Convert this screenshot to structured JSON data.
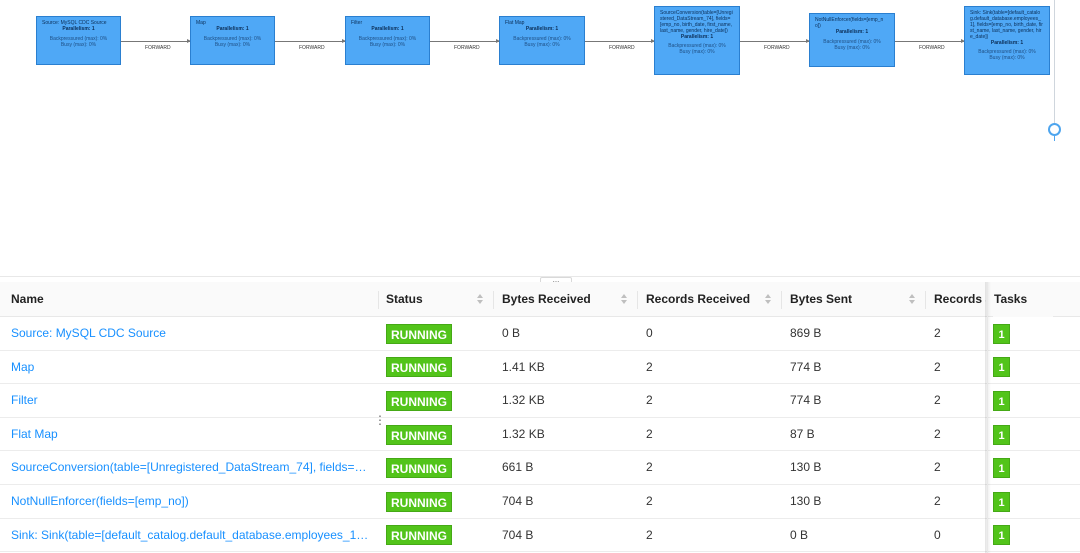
{
  "dag": {
    "nodes": [
      {
        "name": "Source: MySQL CDC Source",
        "parallelism": "Parallelism: 1",
        "backpressured": "Backpressured (max): 0%",
        "busy": "Busy (max): 0%"
      },
      {
        "name": "Map",
        "parallelism": "Parallelism: 1",
        "backpressured": "Backpressured (max): 0%",
        "busy": "Busy (max): 0%"
      },
      {
        "name": "Filter",
        "parallelism": "Parallelism: 1",
        "backpressured": "Backpressured (max): 0%",
        "busy": "Busy (max): 0%"
      },
      {
        "name": "Flat Map",
        "parallelism": "Parallelism: 1",
        "backpressured": "Backpressured (max): 0%",
        "busy": "Busy (max): 0%"
      },
      {
        "name": "SourceConversion(table=[Unregistered_DataStream_74], fields=[emp_no, birth_date, first_name, last_name, gender, hire_date])",
        "parallelism": "Parallelism: 1",
        "backpressured": "Backpressured (max): 0%",
        "busy": "Busy (max): 0%"
      },
      {
        "name": "NotNullEnforcer(fields=[emp_no])",
        "parallelism": "Parallelism: 1",
        "backpressured": "Backpressured (max): 0%",
        "busy": "Busy (max): 0%"
      },
      {
        "name": "Sink: Sink(table=[default_catalog.default_database.employees_1], fields=[emp_no, birth_date, first_name, last_name, gender, hire_date])",
        "parallelism": "Parallelism: 1",
        "backpressured": "Backpressured (max): 0%",
        "busy": "Busy (max): 0%"
      }
    ],
    "edge_label": "FORWARD",
    "splitter_handle": "..."
  },
  "table": {
    "columns": {
      "name": "Name",
      "status": "Status",
      "bytes_received": "Bytes Received",
      "records_received": "Records Received",
      "bytes_sent": "Bytes Sent",
      "records_sent": "Records Sent",
      "tasks": "Tasks"
    },
    "rows": [
      {
        "name": "Source: MySQL CDC Source",
        "status": "RUNNING",
        "bytes_received": "0 B",
        "records_received": "0",
        "bytes_sent": "869 B",
        "records_sent": "2",
        "tasks": "1"
      },
      {
        "name": "Map",
        "status": "RUNNING",
        "bytes_received": "1.41 KB",
        "records_received": "2",
        "bytes_sent": "774 B",
        "records_sent": "2",
        "tasks": "1"
      },
      {
        "name": "Filter",
        "status": "RUNNING",
        "bytes_received": "1.32 KB",
        "records_received": "2",
        "bytes_sent": "774 B",
        "records_sent": "2",
        "tasks": "1"
      },
      {
        "name": "Flat Map",
        "status": "RUNNING",
        "bytes_received": "1.32 KB",
        "records_received": "2",
        "bytes_sent": "87 B",
        "records_sent": "2",
        "tasks": "1"
      },
      {
        "name": "SourceConversion(table=[Unregistered_DataStream_74], fields=…",
        "status": "RUNNING",
        "bytes_received": "661 B",
        "records_received": "2",
        "bytes_sent": "130 B",
        "records_sent": "2",
        "tasks": "1"
      },
      {
        "name": "NotNullEnforcer(fields=[emp_no])",
        "status": "RUNNING",
        "bytes_received": "704 B",
        "records_received": "2",
        "bytes_sent": "130 B",
        "records_sent": "2",
        "tasks": "1"
      },
      {
        "name": "Sink: Sink(table=[default_catalog.default_database.employees_1…",
        "status": "RUNNING",
        "bytes_received": "704 B",
        "records_received": "2",
        "bytes_sent": "0 B",
        "records_sent": "0",
        "tasks": "1"
      }
    ],
    "colors": {
      "running": "#52c41a",
      "link": "#1890ff",
      "node": "#4fa8f6"
    }
  }
}
